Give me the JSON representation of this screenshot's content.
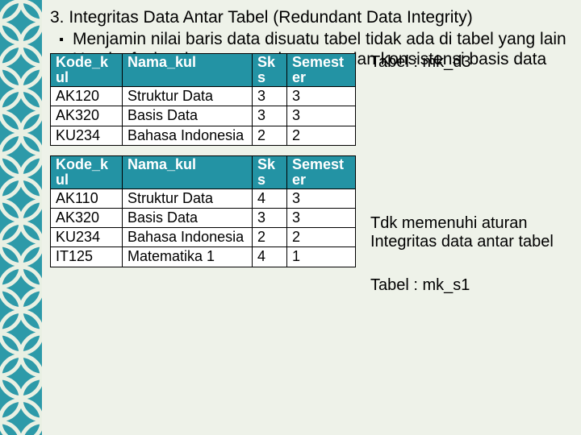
{
  "heading": "3. Integritas Data Antar Tabel (Redundant Data Integrity)",
  "bullets": [
    "Menjamin nilai baris data disuatu tabel tidak ada di tabel yang lain",
    "Untuk efesiensi ruang penyimpanan dan konsistensi basis data"
  ],
  "table_headers": {
    "c0": "Kode_k\nul",
    "c1": "Nama_kul",
    "c2": "Sk\ns",
    "c3": "Semest\ner"
  },
  "table1": [
    {
      "c0": "AK120",
      "c1": "Struktur Data",
      "c2": "3",
      "c3": "3"
    },
    {
      "c0": "AK320",
      "c1": "Basis Data",
      "c2": "3",
      "c3": "3"
    },
    {
      "c0": "KU234",
      "c1": "Bahasa Indonesia",
      "c2": "2",
      "c3": "2"
    }
  ],
  "table2": [
    {
      "c0": "AK110",
      "c1": "Struktur Data",
      "c2": "4",
      "c3": "3"
    },
    {
      "c0": "AK320",
      "c1": "Basis Data",
      "c2": "3",
      "c3": "3"
    },
    {
      "c0": "KU234",
      "c1": "Bahasa Indonesia",
      "c2": "2",
      "c3": "2"
    },
    {
      "c0": "IT125",
      "c1": "Matematika 1",
      "c2": "4",
      "c3": "1"
    }
  ],
  "captions": {
    "top": "Tabel : mk_d3",
    "mid": "Tdk memenuhi aturan Integritas data antar tabel",
    "bottom": "Tabel : mk_s1"
  }
}
